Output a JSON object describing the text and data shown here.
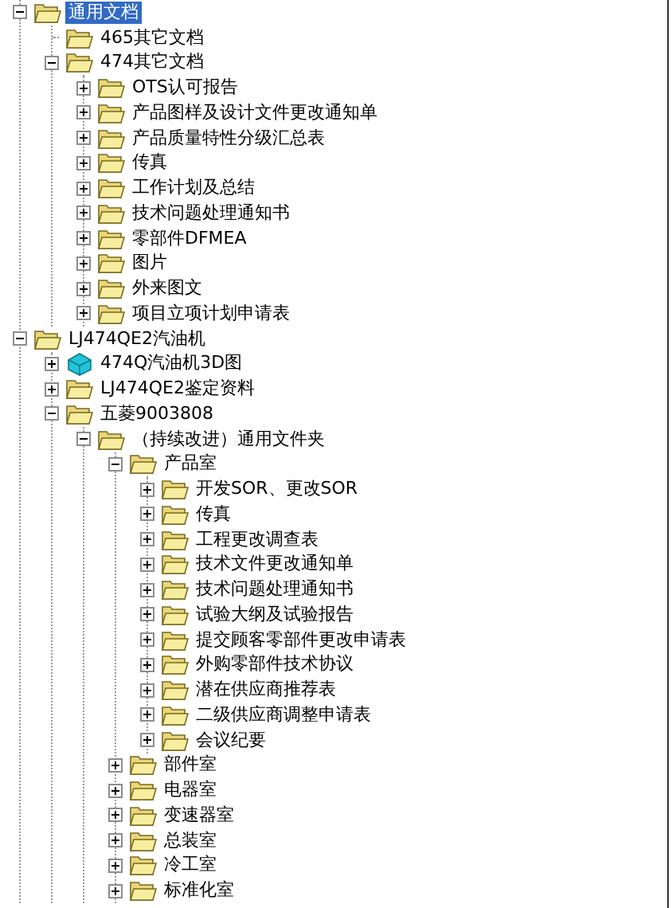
{
  "tree": [
    {
      "label": "通用文档",
      "kind": "folder",
      "expandable": true,
      "expanded": true,
      "selected": true,
      "children": [
        {
          "label": "465其它文档",
          "kind": "folder",
          "expandable": false,
          "selected": false
        },
        {
          "label": "474其它文档",
          "kind": "folder",
          "expandable": true,
          "expanded": true,
          "selected": false,
          "children": [
            {
              "label": "OTS认可报告",
              "kind": "folder",
              "expandable": true,
              "expanded": false,
              "selected": false
            },
            {
              "label": "产品图样及设计文件更改通知单",
              "kind": "folder",
              "expandable": true,
              "expanded": false,
              "selected": false
            },
            {
              "label": "产品质量特性分级汇总表",
              "kind": "folder",
              "expandable": true,
              "expanded": false,
              "selected": false
            },
            {
              "label": "传真",
              "kind": "folder",
              "expandable": true,
              "expanded": false,
              "selected": false
            },
            {
              "label": "工作计划及总结",
              "kind": "folder",
              "expandable": true,
              "expanded": false,
              "selected": false
            },
            {
              "label": "技术问题处理通知书",
              "kind": "folder",
              "expandable": true,
              "expanded": false,
              "selected": false
            },
            {
              "label": "零部件DFMEA",
              "kind": "folder",
              "expandable": true,
              "expanded": false,
              "selected": false
            },
            {
              "label": "图片",
              "kind": "folder",
              "expandable": true,
              "expanded": false,
              "selected": false
            },
            {
              "label": "外来图文",
              "kind": "folder",
              "expandable": true,
              "expanded": false,
              "selected": false
            },
            {
              "label": "项目立项计划申请表",
              "kind": "folder",
              "expandable": true,
              "expanded": false,
              "selected": false
            }
          ]
        }
      ]
    },
    {
      "label": "LJ474QE2汽油机",
      "kind": "folder",
      "expandable": true,
      "expanded": true,
      "selected": false,
      "children": [
        {
          "label": "474Q汽油机3D图",
          "kind": "model",
          "expandable": true,
          "expanded": false,
          "selected": false
        },
        {
          "label": "LJ474QE2鉴定资料",
          "kind": "folder",
          "expandable": true,
          "expanded": false,
          "selected": false
        },
        {
          "label": "五菱9003808",
          "kind": "folder",
          "expandable": true,
          "expanded": true,
          "selected": false,
          "children": [
            {
              "label": "（持续改进）通用文件夹",
              "kind": "folder",
              "expandable": true,
              "expanded": true,
              "selected": false,
              "children": [
                {
                  "label": "产品室",
                  "kind": "folder",
                  "expandable": true,
                  "expanded": true,
                  "selected": false,
                  "children": [
                    {
                      "label": "开发SOR、更改SOR",
                      "kind": "folder",
                      "expandable": true,
                      "expanded": false,
                      "selected": false
                    },
                    {
                      "label": "传真",
                      "kind": "folder",
                      "expandable": true,
                      "expanded": false,
                      "selected": false
                    },
                    {
                      "label": "工程更改调查表",
                      "kind": "folder",
                      "expandable": true,
                      "expanded": false,
                      "selected": false
                    },
                    {
                      "label": "技术文件更改通知单",
                      "kind": "folder",
                      "expandable": true,
                      "expanded": false,
                      "selected": false
                    },
                    {
                      "label": "技术问题处理通知书",
                      "kind": "folder",
                      "expandable": true,
                      "expanded": false,
                      "selected": false
                    },
                    {
                      "label": "试验大纲及试验报告",
                      "kind": "folder",
                      "expandable": true,
                      "expanded": false,
                      "selected": false
                    },
                    {
                      "label": "提交顾客零部件更改申请表",
                      "kind": "folder",
                      "expandable": true,
                      "expanded": false,
                      "selected": false
                    },
                    {
                      "label": "外购零部件技术协议",
                      "kind": "folder",
                      "expandable": true,
                      "expanded": false,
                      "selected": false
                    },
                    {
                      "label": "潜在供应商推荐表",
                      "kind": "folder",
                      "expandable": true,
                      "expanded": false,
                      "selected": false
                    },
                    {
                      "label": "二级供应商调整申请表",
                      "kind": "folder",
                      "expandable": true,
                      "expanded": false,
                      "selected": false
                    },
                    {
                      "label": "会议纪要",
                      "kind": "folder",
                      "expandable": true,
                      "expanded": false,
                      "selected": false
                    }
                  ]
                },
                {
                  "label": "部件室",
                  "kind": "folder",
                  "expandable": true,
                  "expanded": false,
                  "selected": false
                },
                {
                  "label": "电器室",
                  "kind": "folder",
                  "expandable": true,
                  "expanded": false,
                  "selected": false
                },
                {
                  "label": "变速器室",
                  "kind": "folder",
                  "expandable": true,
                  "expanded": false,
                  "selected": false
                },
                {
                  "label": "总装室",
                  "kind": "folder",
                  "expandable": true,
                  "expanded": false,
                  "selected": false
                },
                {
                  "label": "冷工室",
                  "kind": "folder",
                  "expandable": true,
                  "expanded": false,
                  "selected": false
                },
                {
                  "label": "标准化室",
                  "kind": "folder",
                  "expandable": true,
                  "expanded": false,
                  "selected": false
                }
              ]
            }
          ]
        }
      ]
    }
  ]
}
